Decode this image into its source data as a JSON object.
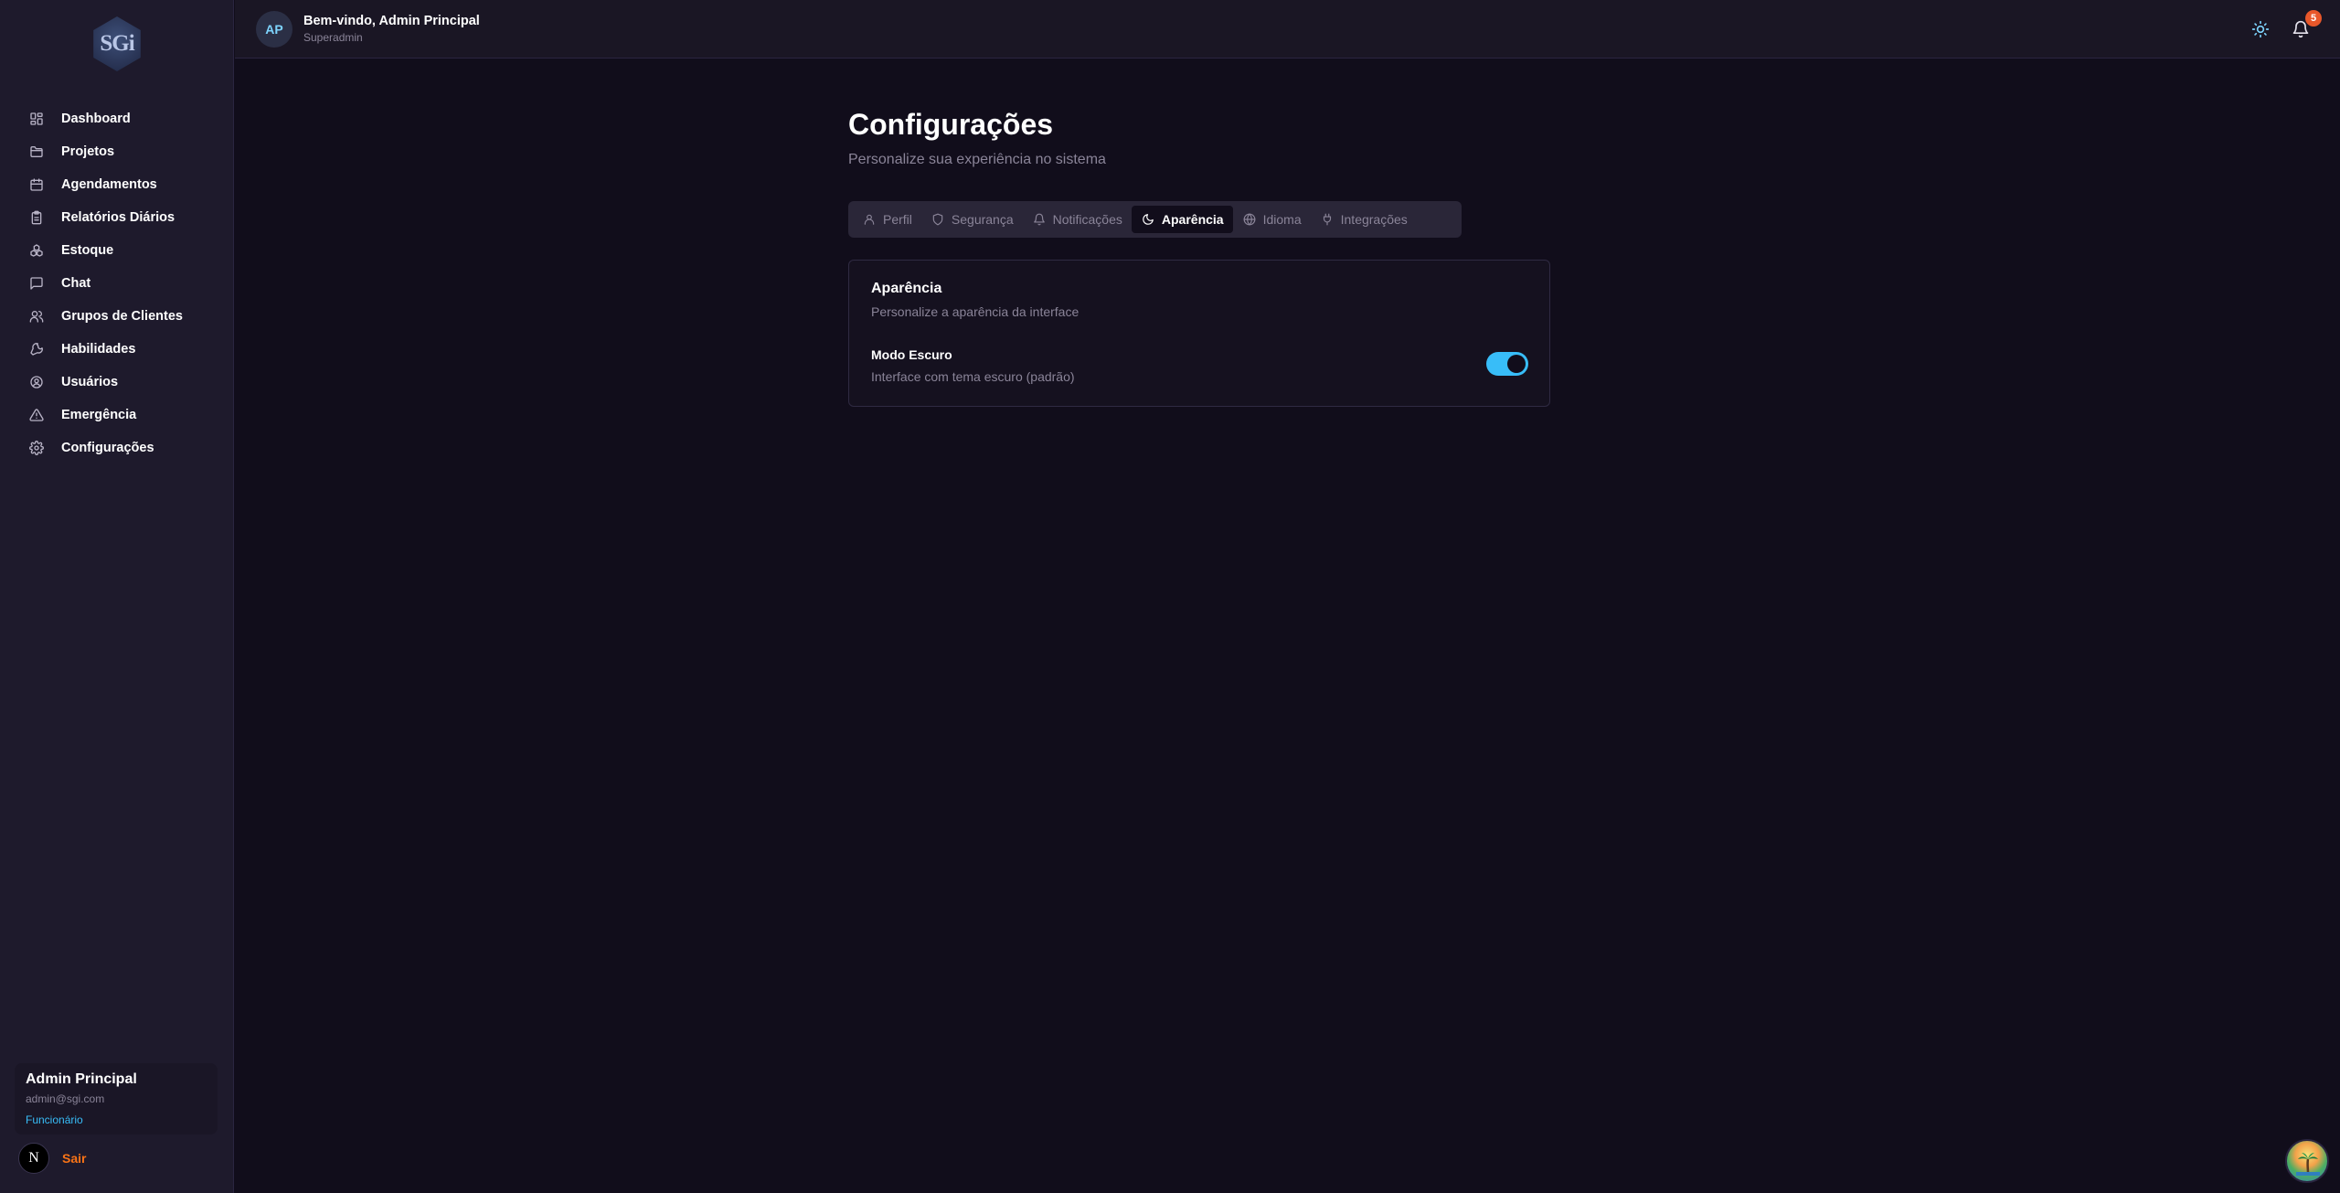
{
  "sidebar": {
    "logo_text": "SGi",
    "items": [
      {
        "label": "Dashboard",
        "icon": "dashboard-icon"
      },
      {
        "label": "Projetos",
        "icon": "folder-icon"
      },
      {
        "label": "Agendamentos",
        "icon": "calendar-icon"
      },
      {
        "label": "Relatórios Diários",
        "icon": "clipboard-icon"
      },
      {
        "label": "Estoque",
        "icon": "boxes-icon"
      },
      {
        "label": "Chat",
        "icon": "chat-icon"
      },
      {
        "label": "Grupos de Clientes",
        "icon": "users-icon"
      },
      {
        "label": "Habilidades",
        "icon": "wrench-icon"
      },
      {
        "label": "Usuários",
        "icon": "user-circle-icon"
      },
      {
        "label": "Emergência",
        "icon": "alert-triangle-icon"
      },
      {
        "label": "Configurações",
        "icon": "gear-icon"
      }
    ],
    "user": {
      "name": "Admin Principal",
      "email": "admin@sgi.com",
      "role": "Funcionário"
    },
    "avatar_letter": "N",
    "logout_label": "Sair"
  },
  "header": {
    "avatar_initials": "AP",
    "welcome": "Bem-vindo, Admin Principal",
    "role": "Superadmin",
    "notification_count": "5",
    "theme_icon": "sun-icon",
    "notification_icon": "bell-icon"
  },
  "page": {
    "title": "Configurações",
    "subtitle": "Personalize sua experiência no sistema"
  },
  "tabs": [
    {
      "label": "Perfil",
      "icon": "user-icon",
      "active": false
    },
    {
      "label": "Segurança",
      "icon": "shield-icon",
      "active": false
    },
    {
      "label": "Notificações",
      "icon": "bell-icon",
      "active": false
    },
    {
      "label": "Aparência",
      "icon": "moon-icon",
      "active": true
    },
    {
      "label": "Idioma",
      "icon": "globe-icon",
      "active": false
    },
    {
      "label": "Integrações",
      "icon": "plug-icon",
      "active": false
    }
  ],
  "appearance": {
    "title": "Aparência",
    "description": "Personalize a aparência da interface",
    "dark_mode_label": "Modo Escuro",
    "dark_mode_desc": "Interface com tema escuro (padrão)",
    "dark_mode_enabled": true
  },
  "colors": {
    "accent": "#38bdf8",
    "logout": "#f97316",
    "badge": "#e8572a",
    "background": "#110d1b",
    "sidebar": "#1e1a2c"
  }
}
